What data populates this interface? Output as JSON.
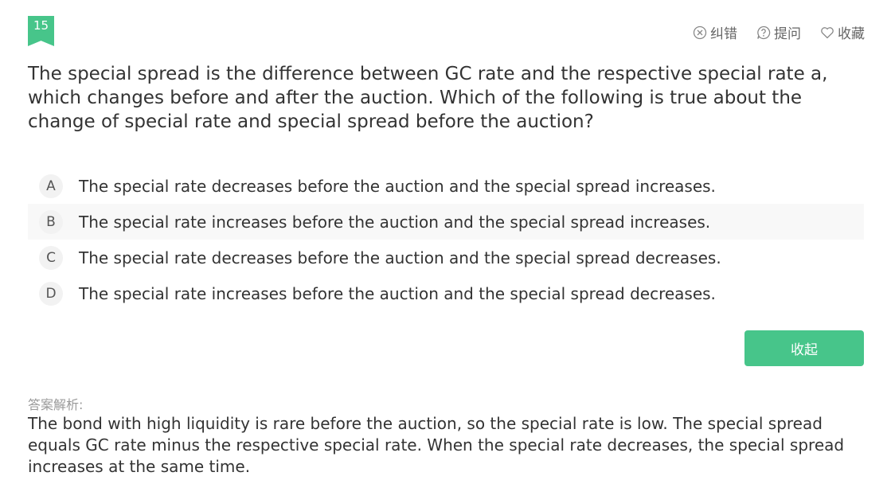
{
  "question_number": "15",
  "actions": {
    "report_error": "纠错",
    "ask_question": "提问",
    "favorite": "收藏"
  },
  "question": {
    "text": "The special spread is the difference between GC rate and the respective special rate a, which changes before and after the auction. Which of the following is true about the change of special rate and special spread before the auction?"
  },
  "options": [
    {
      "letter": "A",
      "text": "The special rate decreases before the auction and the special spread increases."
    },
    {
      "letter": "B",
      "text": "The special rate increases before the auction and the special spread increases."
    },
    {
      "letter": "C",
      "text": "The special rate decreases before the auction and the special spread decreases."
    },
    {
      "letter": "D",
      "text": "The special rate increases before the auction and the special spread decreases."
    }
  ],
  "collapse_button": "收起",
  "analysis": {
    "label": "答案解析:",
    "text": "The bond with high liquidity is rare before the auction, so the special rate is low. The special spread equals GC rate minus the respective special rate. When the special rate decreases, the special spread increases at the same time."
  },
  "colors": {
    "accent": "#47c58a",
    "option_hover_bg": "#f8f8f8"
  }
}
